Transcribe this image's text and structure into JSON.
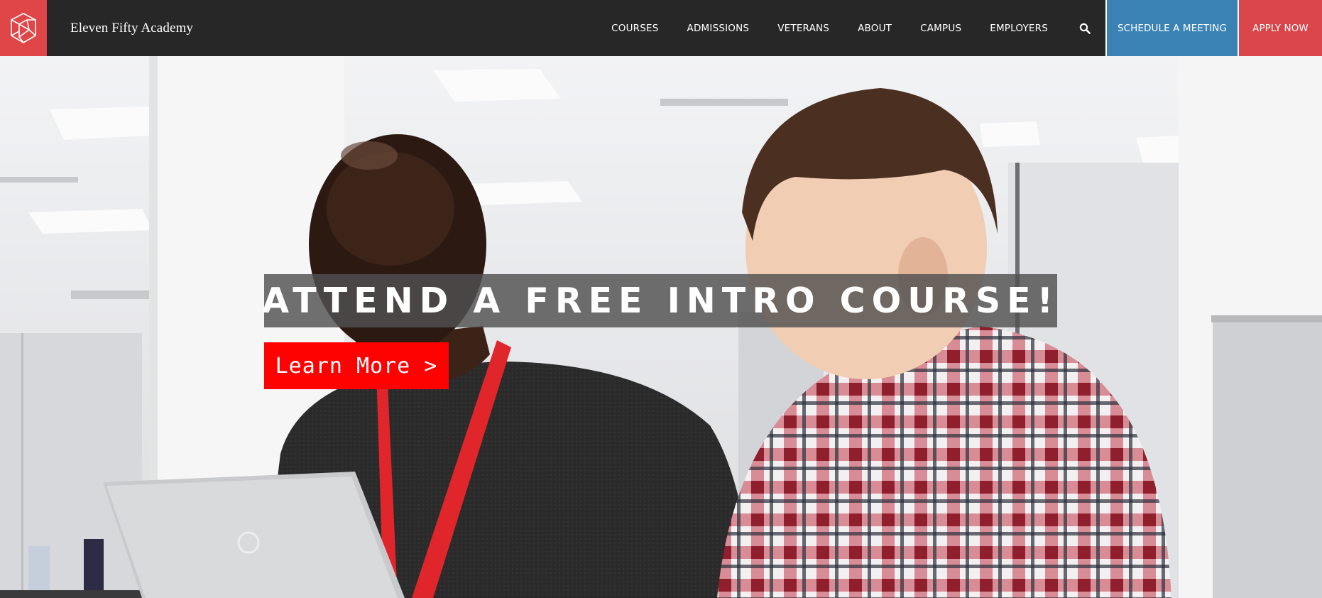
{
  "header": {
    "brand": "Eleven Fifty Academy",
    "logo_icon": "geometric-cube-logo",
    "nav": [
      {
        "label": "COURSES"
      },
      {
        "label": "ADMISSIONS"
      },
      {
        "label": "VETERANS"
      },
      {
        "label": "ABOUT"
      },
      {
        "label": "CAMPUS"
      },
      {
        "label": "EMPLOYERS"
      }
    ],
    "search_icon": "search-icon",
    "schedule_label": "SCHEDULE A MEETING",
    "apply_label": "APPLY NOW"
  },
  "hero": {
    "headline": "ATTEND A FREE INTRO COURSE!",
    "cta_label": "Learn More >"
  },
  "colors": {
    "header_bg": "#272727",
    "logo_red": "#e04648",
    "schedule_blue": "#3a82b4",
    "apply_red": "#d94548",
    "cta_red": "#fe0101"
  }
}
